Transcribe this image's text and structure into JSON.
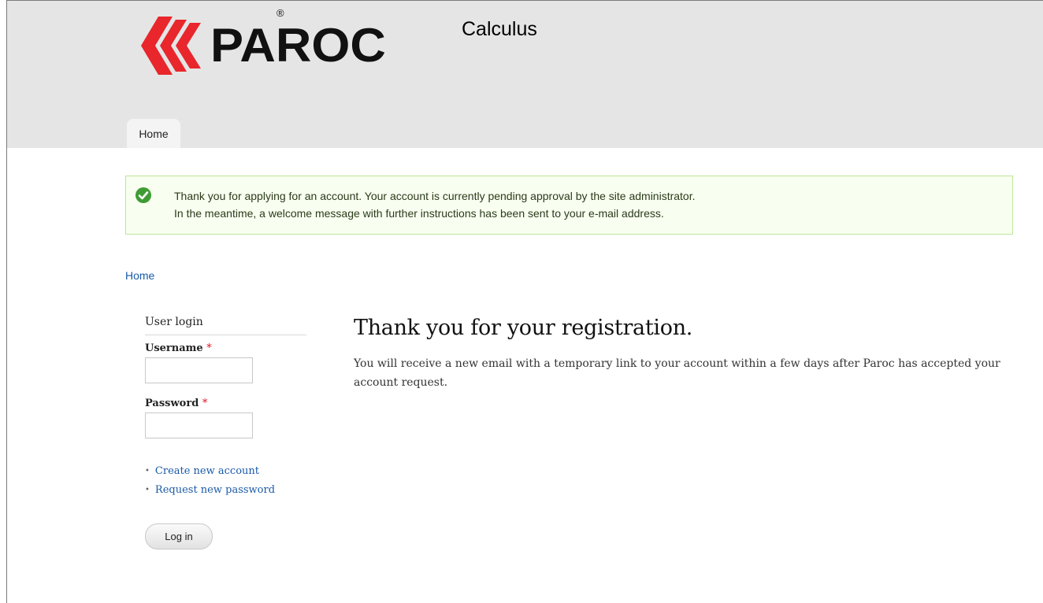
{
  "header": {
    "brand": "PAROC",
    "brand_mark": "®",
    "site_name": "Calculus",
    "tabs": [
      {
        "label": "Home"
      }
    ]
  },
  "status_message": {
    "icon": "check-circle-icon",
    "line1": "Thank you for applying for an account. Your account is currently pending approval by the site administrator.",
    "line2": "In the meantime, a welcome message with further instructions has been sent to your e-mail address."
  },
  "breadcrumb": {
    "label": "Home"
  },
  "sidebar": {
    "block_title": "User login",
    "username_label": "Username",
    "password_label": "Password",
    "required_mark": "*",
    "username_value": "",
    "password_value": "",
    "links": [
      {
        "label": "Create new account"
      },
      {
        "label": "Request new password"
      }
    ],
    "login_button": "Log in"
  },
  "main": {
    "title": "Thank you for your registration.",
    "body": "You will receive a new email with a temporary link to your account within a few days after Paroc has accepted your account request."
  },
  "colors": {
    "brand_red": "#e8262c",
    "link": "#1a5aa8",
    "status_bg": "#f8fff0",
    "status_border": "#bde59b",
    "status_icon": "#3f9c35"
  }
}
